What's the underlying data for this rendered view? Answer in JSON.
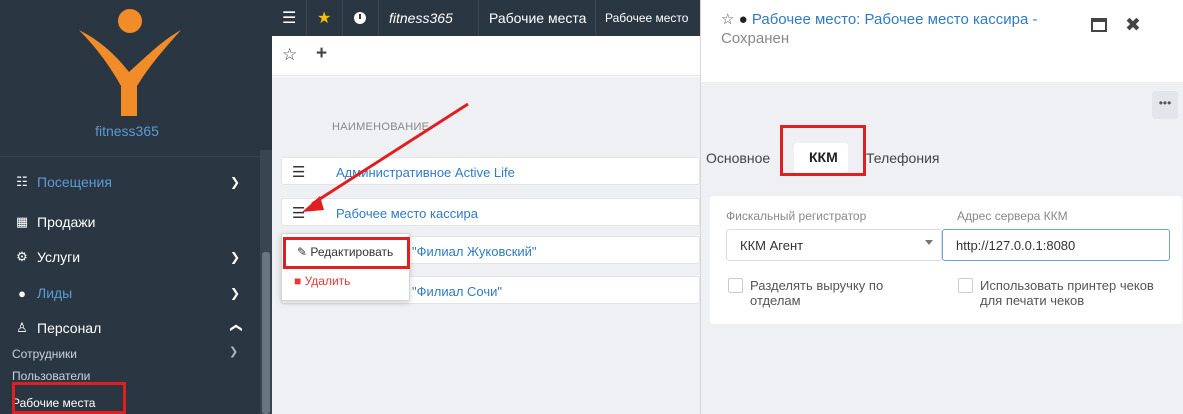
{
  "sidebar": {
    "logo_text": "fitness365",
    "items": [
      {
        "label": "Посещения",
        "icon": "calendar-icon"
      },
      {
        "label": "Продажи",
        "icon": "cash-register-icon"
      },
      {
        "label": "Услуги",
        "icon": "gear-icon"
      },
      {
        "label": "Лиды",
        "icon": "person-icon"
      },
      {
        "label": "Персонал",
        "icon": "people-icon"
      }
    ],
    "sub_items": [
      "Сотрудники",
      "Пользователи",
      "Рабочие места"
    ]
  },
  "topbar": {
    "brand": "fitness365",
    "tab1": "Рабочие места",
    "tab2": "Рабочее место"
  },
  "list": {
    "column_header": "НАИМЕНОВАНИЕ",
    "rows": [
      "Административное Active Life",
      "Рабочее место кассира",
      "\"Филиал Жуковский\"",
      "\"Филиал Сочи\""
    ],
    "row3_prefix": ")",
    "row4_prefix": ")"
  },
  "context_menu": {
    "edit": "Редактировать",
    "delete": "Удалить"
  },
  "panel": {
    "title": "Рабочее место: Рабочее место кассира -",
    "status": "Сохранен",
    "tabs": [
      "Основное",
      "ККМ",
      "Телефония"
    ],
    "fiscal_label": "Фискальный регистратор",
    "fiscal_value": "ККМ Агент",
    "server_label": "Адрес сервера ККМ",
    "server_value": "http://127.0.0.1:8080",
    "check1": "Разделять выручку по отделам",
    "check2": "Использовать принтер чеков для печати чеков",
    "more": "•••"
  },
  "colors": {
    "sidebar_bg": "#2b3643",
    "link_blue": "#2f7bc5",
    "highlight_red": "#e02020",
    "logo_orange": "#f28c28"
  }
}
